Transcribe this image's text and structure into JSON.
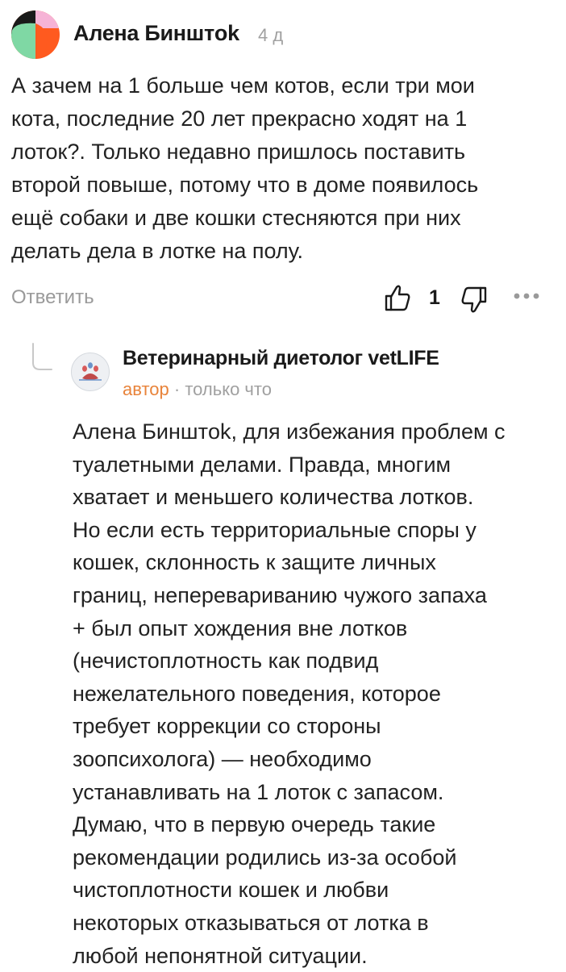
{
  "comment": {
    "author": "Алена Бинштok",
    "time": "4 д",
    "text_lines": [
      "А зачем на 1 больше чем котов, если три мои",
      "кота, последние 20 лет прекрасно ходят на 1",
      "лоток?. Только недавно пришлось поставить",
      "второй повыше, потому что в доме появилось",
      "ещё собаки и две кошки стесняются при них",
      "делать дела в лотке на полу."
    ],
    "reply_label": "Ответить",
    "like_count": "1",
    "avatar_colors": [
      "#ff5a1f",
      "#7fd8a4",
      "#1a1a1a",
      "#f6b3d6"
    ]
  },
  "reply": {
    "author": "Ветеринарный диетолог vetLIFE",
    "badge": "автор",
    "separator": "·",
    "time": "только что",
    "text_lines": [
      "Алена Бинштok, для избежания проблем с",
      "туалетными делами. Правда, многим",
      "хватает и меньшего количества лотков.",
      "Но если есть территориальные споры у",
      "кошек, склонность к защите личных",
      "границ, неперевариванию чужого запаха",
      "+ был опыт хождения вне лотков",
      "(нечистоплотность как подвид",
      "нежелательного поведения, которое",
      "требует коррекции со стороны",
      "зоопсихолога) — необходимо",
      "устанавливать на 1 лоток с запасом.",
      "Думаю, что в первую очередь такие",
      "рекомендации родились из-за особой",
      "чистоплотности кошек и любви",
      "некоторых отказываться от лотка в",
      "любой непонятной ситуации."
    ]
  },
  "colors": {
    "author_badge": "#e8833a",
    "muted": "#a0a0a0",
    "text": "#222222"
  },
  "icons": {
    "like": "thumbs-up-icon",
    "dislike": "thumbs-down-icon",
    "more": "more-dots-icon"
  }
}
